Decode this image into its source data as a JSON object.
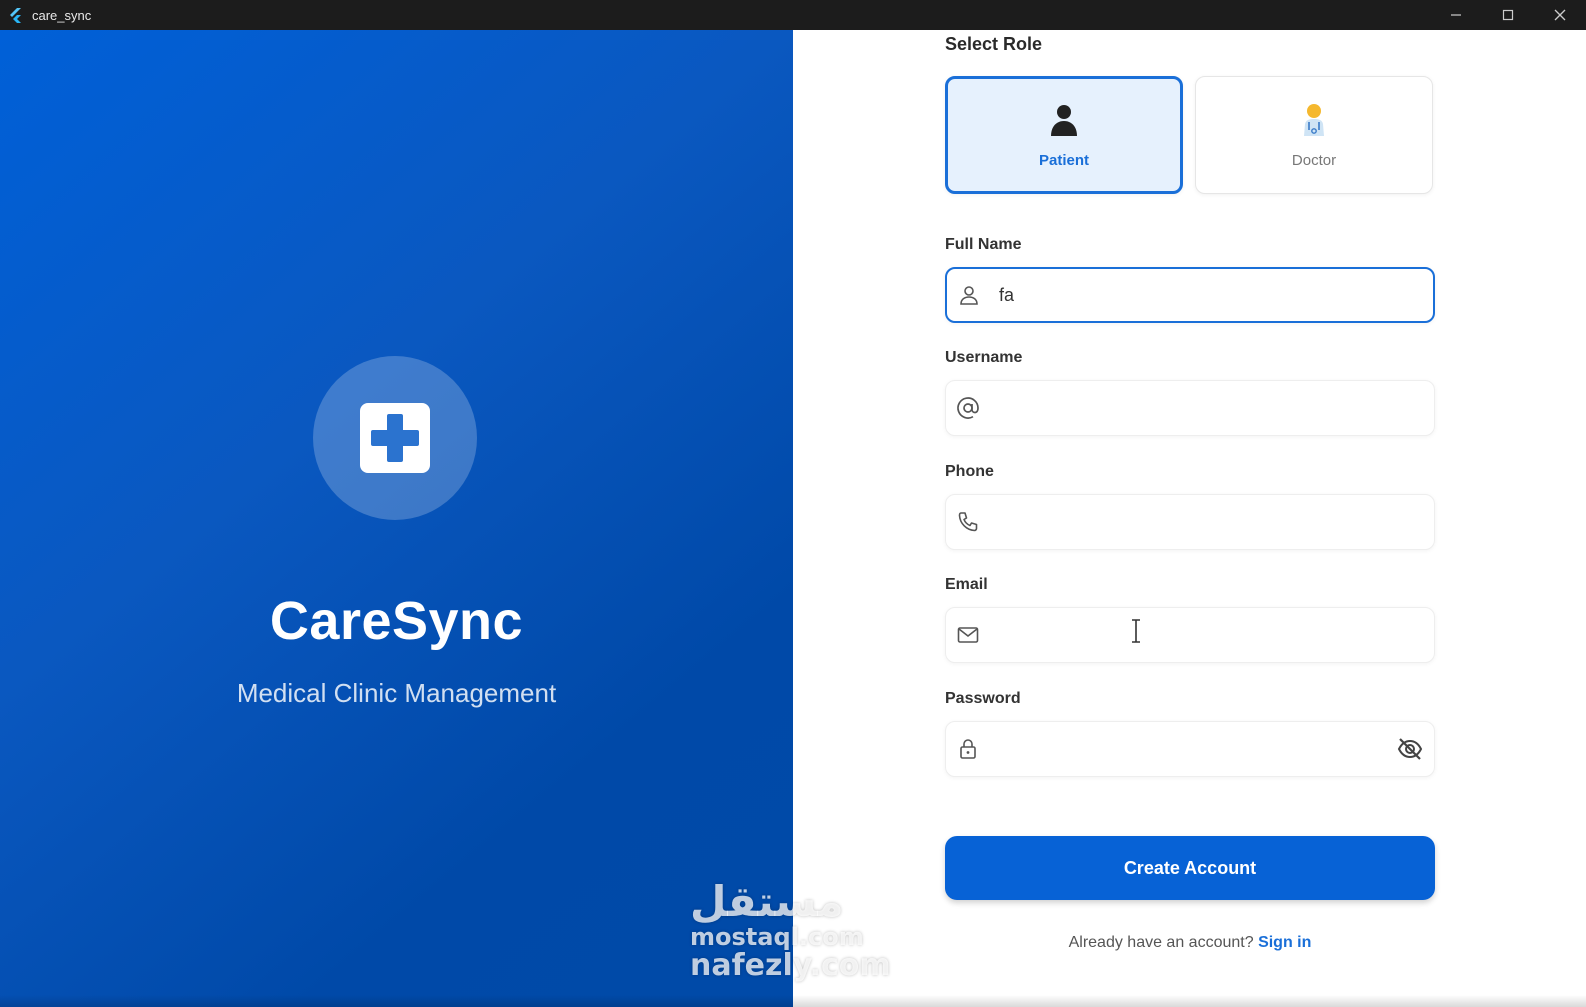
{
  "window": {
    "title": "care_sync",
    "controls": {
      "minimize": "minimize-icon",
      "maximize": "maximize-icon",
      "close": "close-icon"
    }
  },
  "brand": {
    "name": "CareSync",
    "tagline": "Medical Clinic Management",
    "logo_icon": "medical-cross-icon"
  },
  "role_selection": {
    "label": "Select Role",
    "options": [
      {
        "label": "Patient",
        "icon": "patient-icon",
        "selected": true
      },
      {
        "label": "Doctor",
        "icon": "doctor-icon",
        "selected": false
      }
    ]
  },
  "form": {
    "full_name": {
      "label": "Full Name",
      "value": "fa",
      "placeholder": "",
      "icon": "person-icon"
    },
    "username": {
      "label": "Username",
      "value": "",
      "placeholder": "",
      "icon": "at-sign-icon"
    },
    "phone": {
      "label": "Phone",
      "value": "",
      "placeholder": "",
      "icon": "phone-icon"
    },
    "email": {
      "label": "Email",
      "value": "",
      "placeholder": "",
      "icon": "mail-icon"
    },
    "password": {
      "label": "Password",
      "value": "",
      "placeholder": "",
      "icon": "lock-icon",
      "toggle_icon": "eye-off-icon"
    }
  },
  "actions": {
    "create_account": "Create Account",
    "signin_prompt": "Already have an account?",
    "signin_link": "Sign in"
  },
  "watermark": {
    "line1": "مستقل",
    "line2": "mostaql.com",
    "line3": "nafezly.com"
  },
  "colors": {
    "primary": "#0762d6",
    "selected_border": "#1a6fd8",
    "selected_bg": "#e6f1fd",
    "left_panel": "#0055c4"
  }
}
